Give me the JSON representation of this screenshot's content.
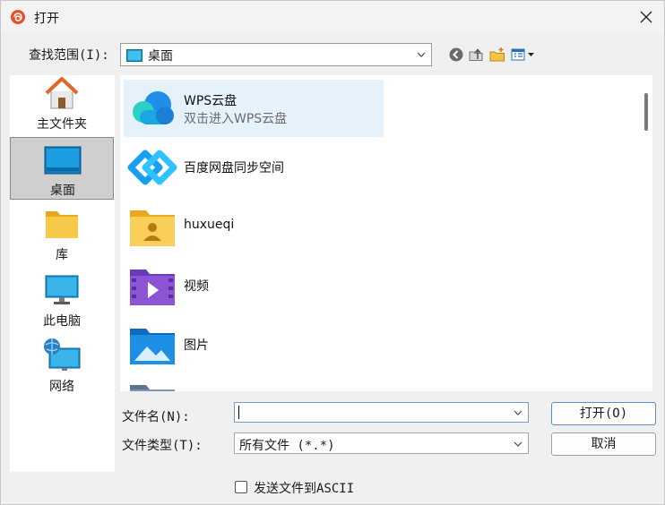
{
  "window": {
    "title": "打开",
    "close_glyph": "✕"
  },
  "lookin": {
    "label": "查找范围(I):",
    "value": "桌面"
  },
  "toolbar": {
    "icons": [
      "back-icon",
      "up-folder-icon",
      "new-folder-icon",
      "view-menu-icon"
    ]
  },
  "sidebar": {
    "items": [
      {
        "label": "主文件夹",
        "icon": "home-icon"
      },
      {
        "label": "桌面",
        "icon": "desktop-icon",
        "selected": true
      },
      {
        "label": "库",
        "icon": "library-folder-icon"
      },
      {
        "label": "此电脑",
        "icon": "computer-icon"
      },
      {
        "label": "网络",
        "icon": "network-icon"
      }
    ]
  },
  "files": [
    {
      "name": "WPS云盘",
      "subtitle": "双击进入WPS云盘",
      "icon": "cloud-icon",
      "selected": true
    },
    {
      "name": "百度网盘同步空间",
      "icon": "baidu-netdisk-icon"
    },
    {
      "name": "huxueqi",
      "icon": "user-folder-icon"
    },
    {
      "name": "视频",
      "icon": "video-folder-icon"
    },
    {
      "name": "图片",
      "icon": "pictures-folder-icon"
    }
  ],
  "filename": {
    "label": "文件名(N):",
    "value": ""
  },
  "filetype": {
    "label": "文件类型(T):",
    "value": "所有文件 (*.*)"
  },
  "buttons": {
    "open": "打开(O)",
    "cancel": "取消"
  },
  "ascii": {
    "label": "发送文件到ASCII",
    "checked": false
  },
  "colors": {
    "accent": "#0078d4",
    "selection": "#e5f1fb",
    "folder_yellow": "#f7c948"
  }
}
